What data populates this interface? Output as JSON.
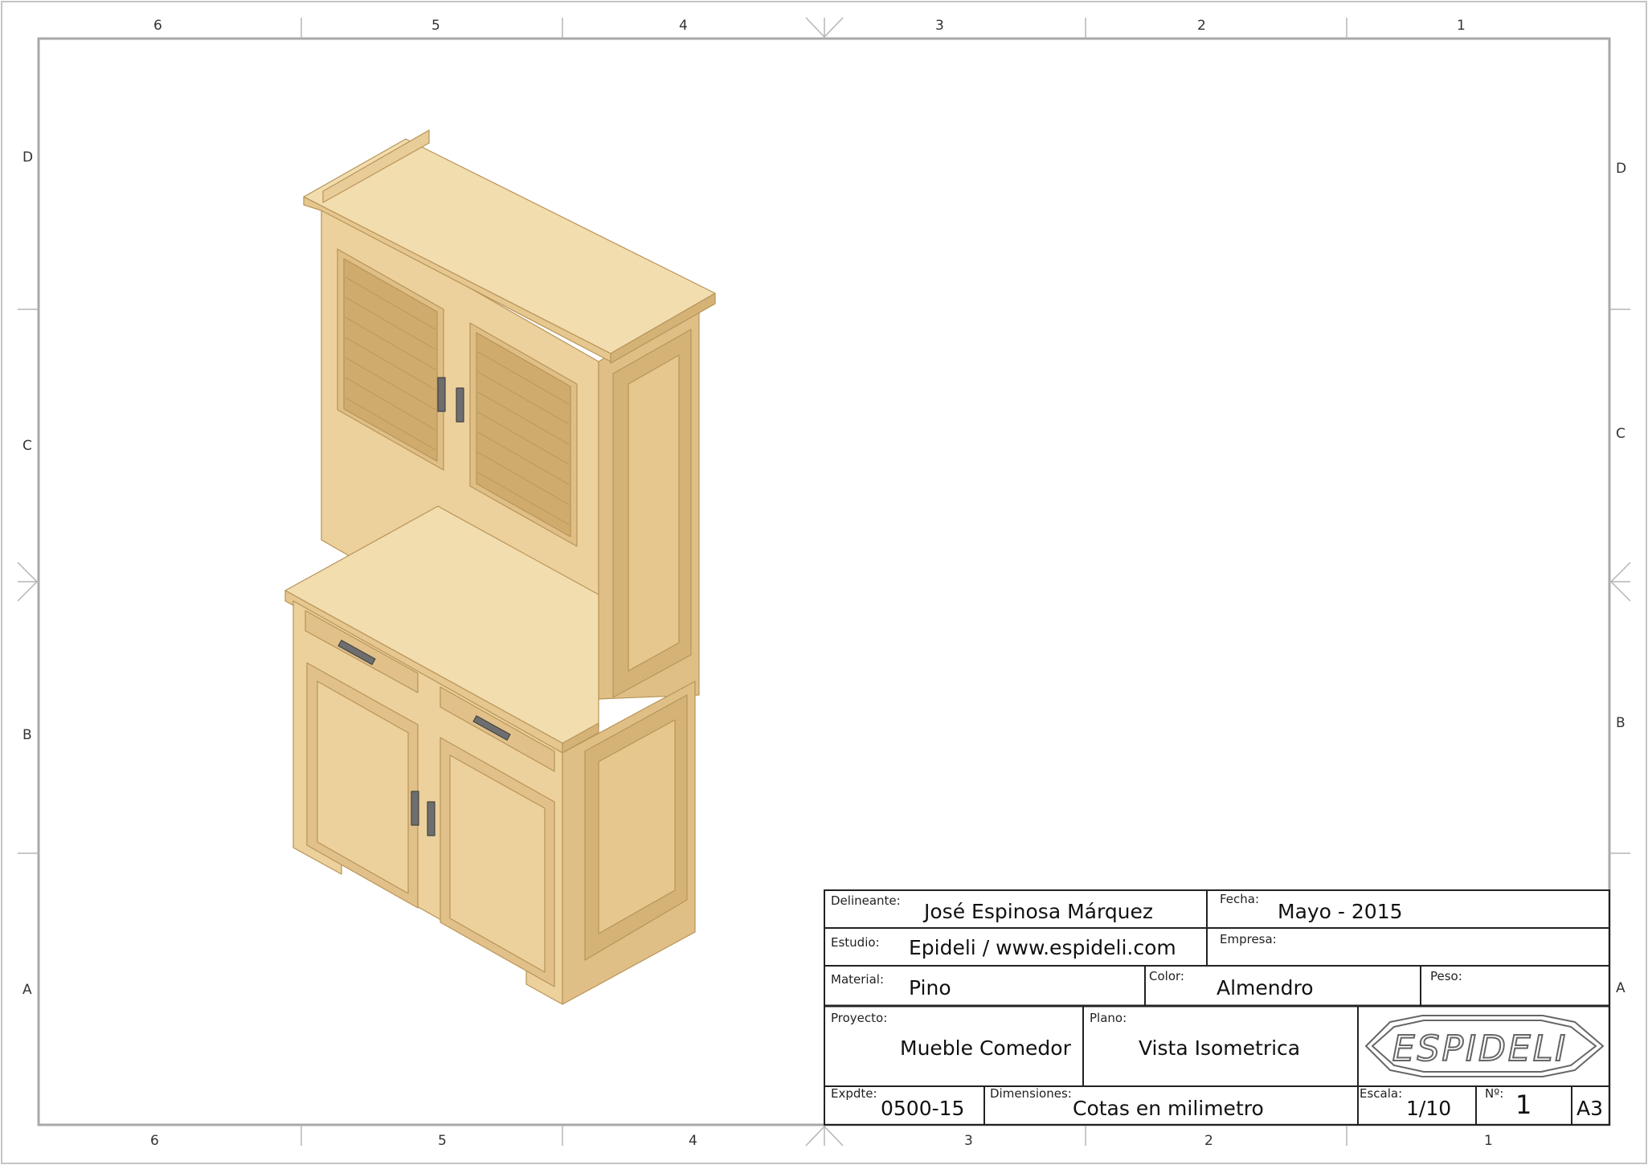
{
  "zones": {
    "columns_top": [
      "6",
      "5",
      "4",
      "3",
      "2",
      "1"
    ],
    "columns_bottom": [
      "6",
      "5",
      "4",
      "3",
      "2",
      "1"
    ],
    "rows_left": [
      "D",
      "C",
      "B",
      "A"
    ],
    "rows_right": [
      "D",
      "C",
      "B",
      "A"
    ]
  },
  "title_block": {
    "delineante_label": "Delineante:",
    "delineante": "José Espinosa Márquez",
    "fecha_label": "Fecha:",
    "fecha": "Mayo - 2015",
    "estudio_label": "Estudio:",
    "estudio": "Epideli / www.espideli.com",
    "empresa_label": "Empresa:",
    "empresa": "",
    "material_label": "Material:",
    "material": "Pino",
    "color_label": "Color:",
    "color": "Almendro",
    "peso_label": "Peso:",
    "peso": "",
    "proyecto_label": "Proyecto:",
    "proyecto": "Mueble Comedor",
    "plano_label": "Plano:",
    "plano": "Vista Isometrica",
    "logo": "ESPIDELI",
    "expdte_label": "Expdte:",
    "expdte": "0500-15",
    "dimensiones_label": "Dimensiones:",
    "dimensiones": "Cotas en milimetro",
    "escala_label": "Escala:",
    "escala": "1/10",
    "numero_label": "Nº:",
    "numero": "1",
    "formato": "A3"
  },
  "colors": {
    "frame": "#b0b0b0",
    "wood_top": "#f2dcae",
    "wood_front": "#e9cd98",
    "wood_side": "#dcbb82",
    "wood_dark": "#c9a56a",
    "handle": "#6e6e6e"
  }
}
